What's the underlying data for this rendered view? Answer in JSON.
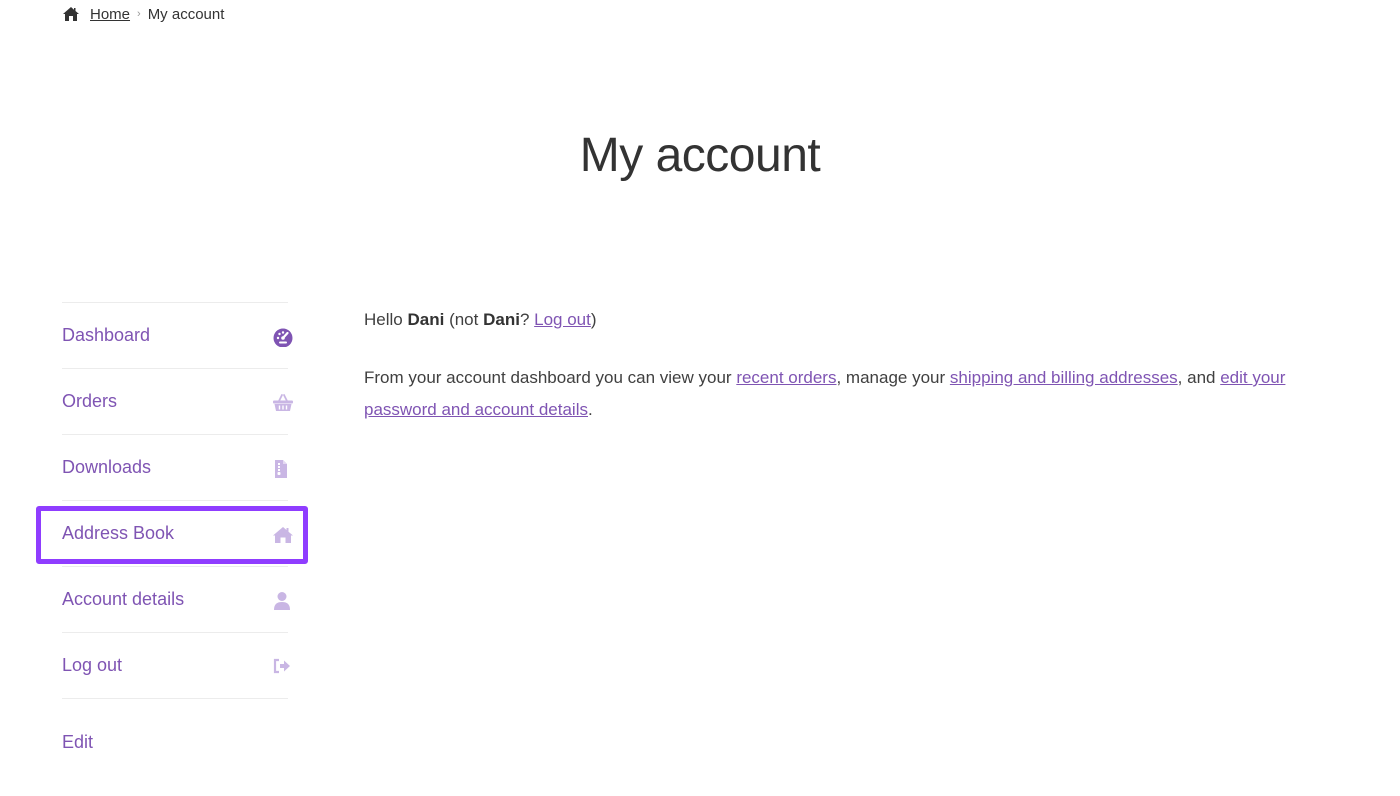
{
  "breadcrumb": {
    "home_icon": "home-icon",
    "home_label": "Home",
    "separator": "›",
    "current": "My account"
  },
  "page_title": "My account",
  "nav": {
    "items": [
      {
        "label": "Dashboard",
        "icon": "dashboard-gauge-icon"
      },
      {
        "label": "Orders",
        "icon": "shopping-basket-icon"
      },
      {
        "label": "Downloads",
        "icon": "file-download-icon"
      },
      {
        "label": "Address Book",
        "icon": "home-icon"
      },
      {
        "label": "Account details",
        "icon": "user-icon"
      },
      {
        "label": "Log out",
        "icon": "sign-out-icon"
      },
      {
        "label": "Edit"
      }
    ],
    "highlighted_item": "Address Book",
    "highlight_color": "#8f3dff"
  },
  "content": {
    "greeting": {
      "hello": "Hello",
      "name": "Dani",
      "not_prefix": "(not",
      "not_name": "Dani",
      "question": "?",
      "logout_link": "Log out",
      "close_paren": ")"
    },
    "description": {
      "part1": "From your account dashboard you can view your",
      "link_orders": "recent orders",
      "part2": ", manage your",
      "link_addresses": "shipping and billing addresses",
      "part3": ", and",
      "link_account": "edit your password and account details",
      "part4": "."
    }
  },
  "colors": {
    "accent": "#7f54b3",
    "accent_light": "#c9b6e4",
    "divider": "#ececec"
  }
}
